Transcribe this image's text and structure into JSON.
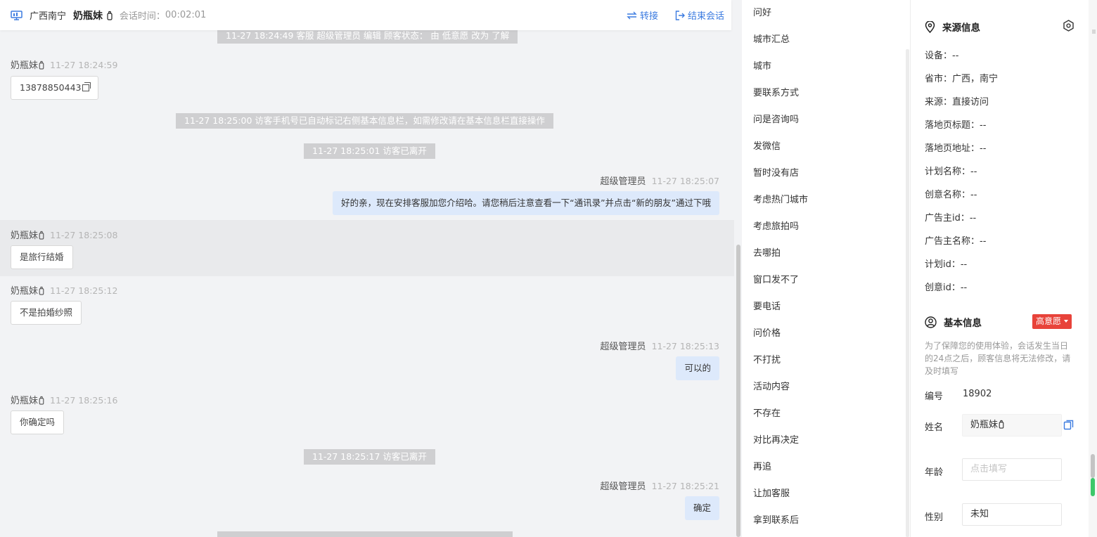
{
  "header": {
    "region": "广西南宁",
    "visitor_name": "奶瓶妹",
    "time_label": "会话时间：",
    "time_value": "00:02:01",
    "transfer_label": "转接",
    "end_label": "结束会话"
  },
  "messages": {
    "sys1": "11-27 18:24:49 客服 超级管理员 编辑 顾客状态： 由 低意愿 改为 了解",
    "m1_sender": "奶瓶妹",
    "m1_time": "11-27 18:24:59",
    "m1_text": "13878850443",
    "sys2": "11-27 18:25:00 访客手机号已自动标记右侧基本信息栏，如需修改请在基本信息栏直接操作",
    "sys3": "11-27 18:25:01 访客已离开",
    "m2_sender": "超级管理员",
    "m2_time": "11-27 18:25:07",
    "m2_text": "好的亲，现在安排客服加您介绍哈。请您稍后注意查看一下“通讯录”并点击“新的朋友”通过下哦",
    "m3_sender": "奶瓶妹",
    "m3_time": "11-27 18:25:08",
    "m3_text": "是旅行结婚",
    "m4_sender": "奶瓶妹",
    "m4_time": "11-27 18:25:12",
    "m4_text": "不是拍婚纱照",
    "m5_sender": "超级管理员",
    "m5_time": "11-27 18:25:13",
    "m5_text": "可以的",
    "m6_sender": "奶瓶妹",
    "m6_time": "11-27 18:25:16",
    "m6_text": "你确定吗",
    "sys4": "11-27 18:25:17 访客已离开",
    "m7_sender": "超级管理员",
    "m7_time": "11-27 18:25:21",
    "m7_text": "确定"
  },
  "quick_replies": [
    "问好",
    "城市汇总",
    "城市",
    "要联系方式",
    "问是咨询吗",
    "发微信",
    "暂时没有店",
    "考虑热门城市",
    "考虑旅拍吗",
    "去哪拍",
    "窗口发不了",
    "要电话",
    "问价格",
    "不打扰",
    "活动内容",
    "不存在",
    "对比再决定",
    "再追",
    "让加客服",
    "拿到联系后"
  ],
  "source_info": {
    "title": "来源信息",
    "device": "设备：--",
    "province_city": "省市：广西，南宁",
    "source": "来源：直接访问",
    "landing_title": "落地页标题：--",
    "landing_url": "落地页地址：--",
    "plan_name": "计划名称：--",
    "creative_name": "创意名称：--",
    "advertiser_id": "广告主id：--",
    "advertiser_name": "广告主名称：--",
    "plan_id": "计划id：--",
    "creative_id": "创意id：--"
  },
  "basic_info": {
    "title": "基本信息",
    "intent": "高意愿",
    "notice": "为了保障您的使用体验，会话发生当日的24点之后，顾客信息将无法修改，请及时填写",
    "id_label": "编号",
    "id_value": "18902",
    "name_label": "姓名",
    "name_value": "奶瓶妹",
    "age_label": "年龄",
    "age_placeholder": "点击填写",
    "gender_label": "性别",
    "gender_value": "未知"
  },
  "colors": {
    "accent": "#3b7be0",
    "intent_badge": "#e8433a",
    "out_bubble": "#dde9fb"
  }
}
